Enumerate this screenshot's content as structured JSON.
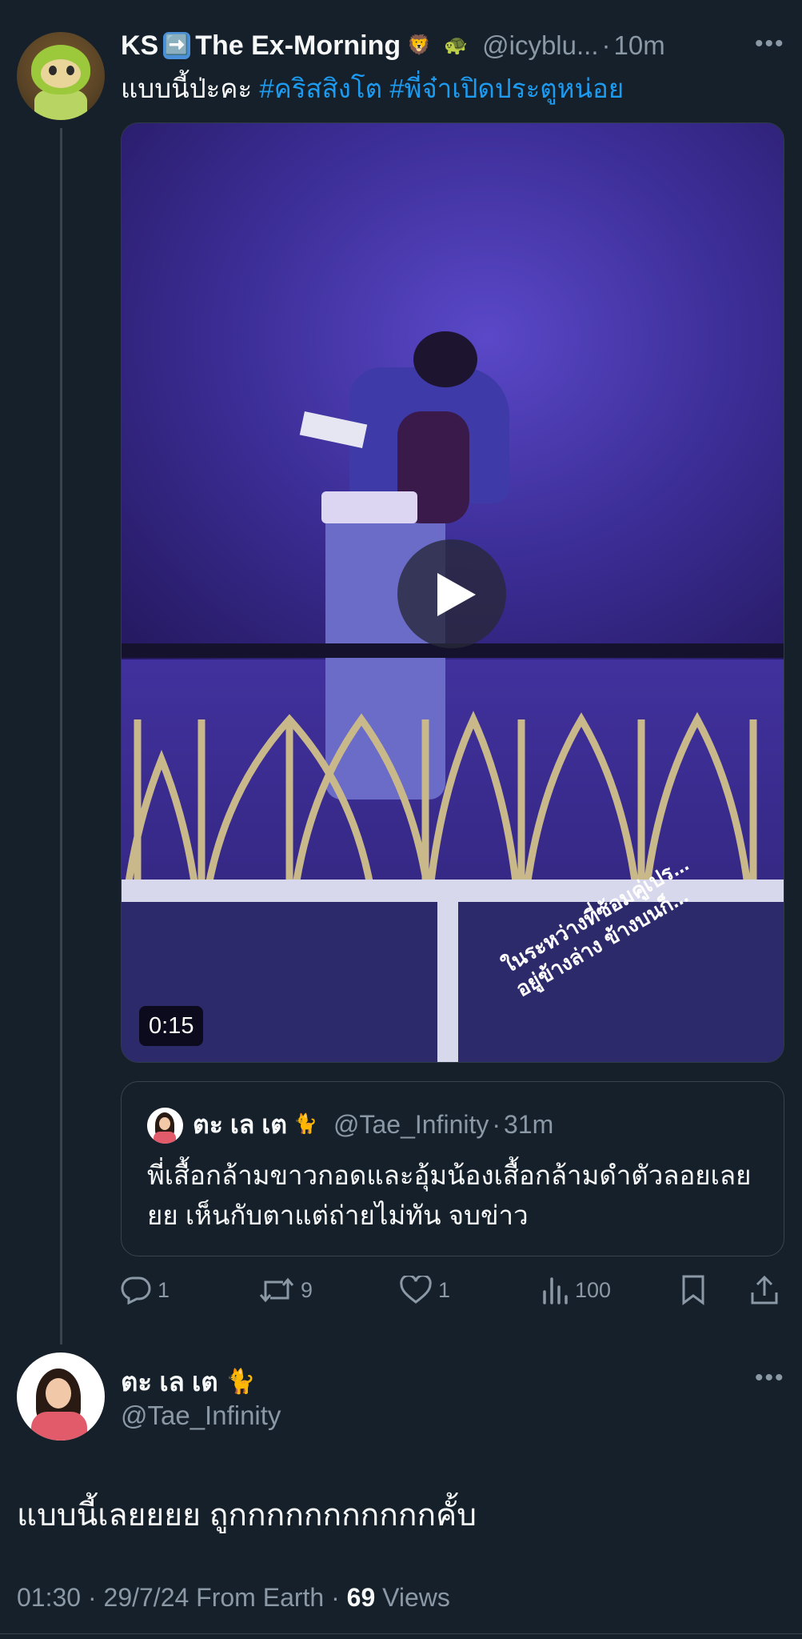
{
  "original_tweet": {
    "display_name": "KS",
    "name_suffix": "The Ex-Morning",
    "emoji_arrow": "➡️",
    "emoji_lion": "🦁",
    "emoji_turtle": "🐢",
    "handle": "@icyblu...",
    "time": "10m",
    "text_plain": "แบบนี้ป่ะคะ",
    "hashtags": [
      "#คริสสิงโต",
      "#พี่จ๋าเปิดประตูหน่อย"
    ],
    "video": {
      "duration": "0:15",
      "overlay_line1": "ในระหว่างที่ซ้อมคู่เปร...",
      "overlay_line2": "อยู่ข้างล่าง ข้างบนก็..."
    }
  },
  "quoted_tweet": {
    "display_name": "ตะ เล เต",
    "emoji": "🐈",
    "handle": "@Tae_Infinity",
    "time": "31m",
    "text": "พี่เสื้อกล้ามขาวกอดและอุ้มน้องเสื้อกล้ามดำตัวลอยเลยยย เห็นกับตาแต่ถ่ายไม่ทัน จบข่าว"
  },
  "actions": {
    "replies": "1",
    "retweets": "9",
    "likes": "1",
    "views": "100"
  },
  "main_tweet": {
    "display_name": "ตะ เล เต",
    "emoji": "🐈",
    "handle": "@Tae_Infinity",
    "text": "แบบนี้เลยยยย ถูกกกกกกกกกกกคั้บ",
    "time": "01:30",
    "date": "29/7/24",
    "source": "From Earth",
    "views_count": "69",
    "views_label": "Views"
  },
  "colors": {
    "background": "#15202b",
    "text": "#f7f9f9",
    "secondary": "#8b98a5",
    "link": "#1d9bf0",
    "divider": "#38444d"
  }
}
